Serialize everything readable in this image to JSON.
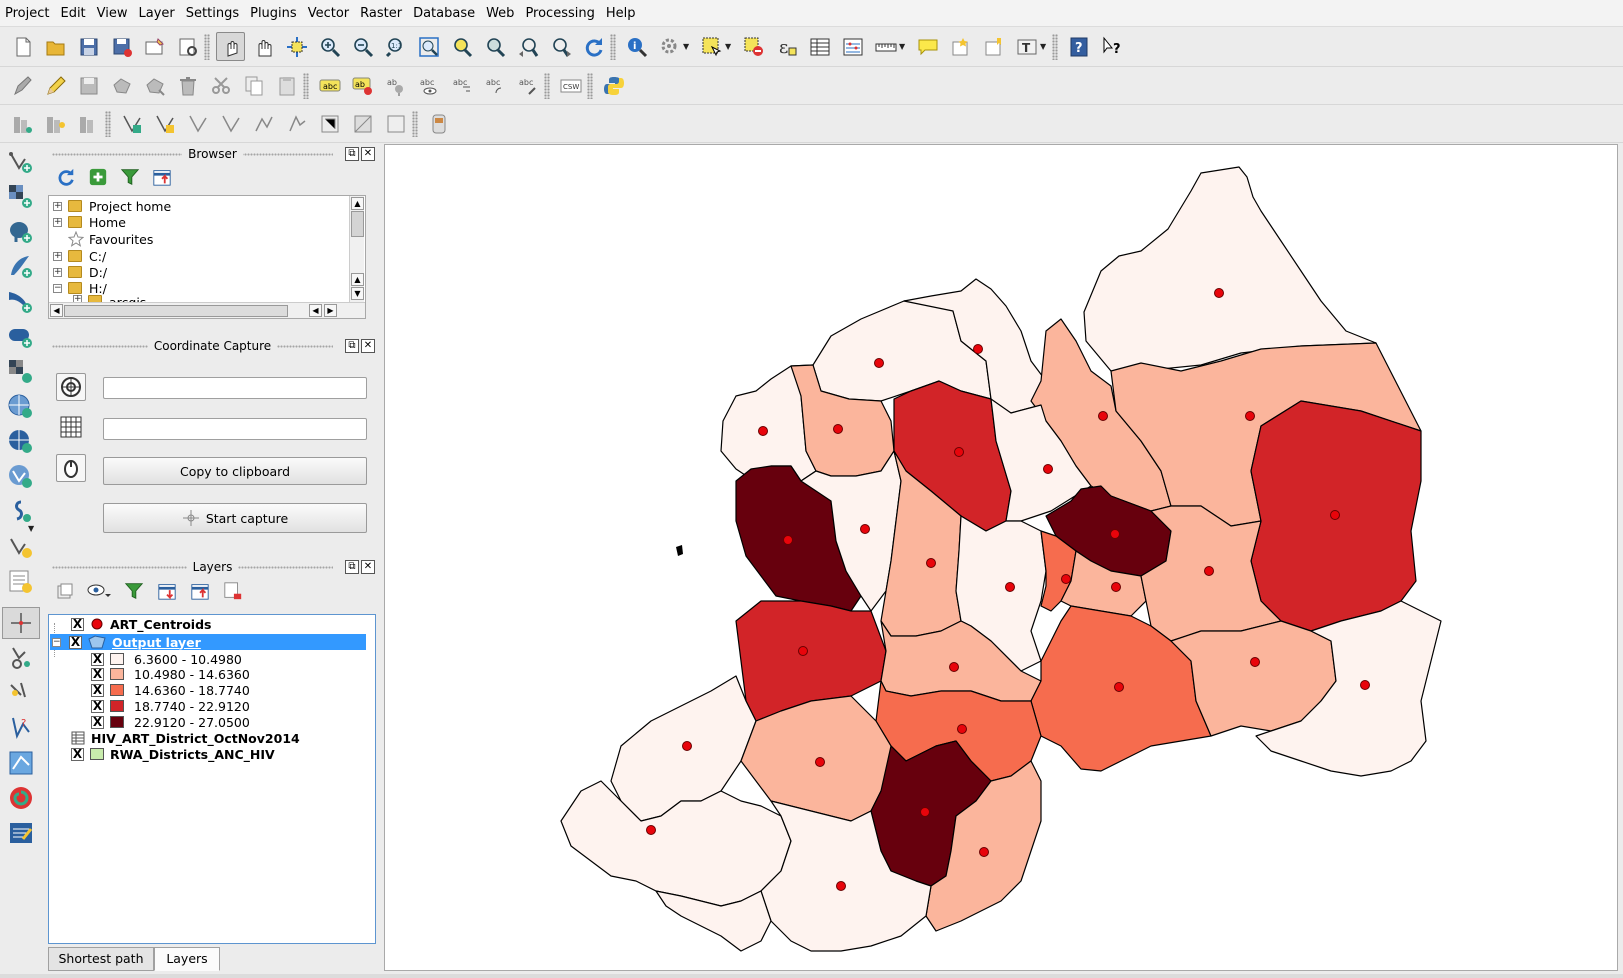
{
  "menubar": {
    "items": [
      "Project",
      "Edit",
      "View",
      "Layer",
      "Settings",
      "Plugins",
      "Vector",
      "Raster",
      "Database",
      "Web",
      "Processing",
      "Help"
    ]
  },
  "toolbars": {
    "row1": [
      "new-project",
      "open-project",
      "save-project",
      "save-as",
      "new-print-composer",
      "composer-manager",
      "touch-zoom-pan",
      "pan-map",
      "pan-to-selection",
      "zoom-in",
      "zoom-out",
      "zoom-native",
      "zoom-full",
      "zoom-to-selection",
      "zoom-to-layer",
      "zoom-last",
      "zoom-next",
      "refresh",
      "identify",
      "action",
      "select-features",
      "deselect",
      "expression-select",
      "attribute-table",
      "statistics",
      "measure",
      "map-tips",
      "new-bookmark",
      "show-bookmarks",
      "annotation",
      "help",
      "whats-this"
    ],
    "row2": [
      "current-edits",
      "toggle-editing",
      "save-layer-edits",
      "add-feature",
      "move-feature",
      "delete-selected",
      "cut-features",
      "copy-features",
      "paste-features",
      "layer-labeling",
      "layer-diagram",
      "pin-labels",
      "show-hide-labels",
      "move-label",
      "rotate-label",
      "change-label",
      "csw-search",
      "python-console"
    ],
    "row3": [
      "digitize-1",
      "digitize-2",
      "digitize-3",
      "add-ring",
      "add-part",
      "fill-ring",
      "delete-ring",
      "delete-part",
      "reshape",
      "offset-curve",
      "split-features",
      "split-parts",
      "gps"
    ]
  },
  "left_toolbar": [
    "add-vector-layer",
    "add-raster-layer",
    "add-postgis-layer",
    "add-spatialite-layer",
    "add-mssql-layer",
    "add-oracle-layer",
    "add-wms-layer",
    "add-wcs-layer",
    "add-wfs-layer",
    "add-delimited-text",
    "new-shapefile",
    "coordinate-capture",
    "georeferencer",
    "topology-checker",
    "heatmap",
    "sql",
    "field-calculator"
  ],
  "browser": {
    "title": "Browser",
    "items": [
      {
        "label": "Project home",
        "icon": "folder-icon",
        "expand": "+"
      },
      {
        "label": "Home",
        "icon": "folder-icon",
        "expand": "+"
      },
      {
        "label": "Favourites",
        "icon": "star-icon",
        "expand": ""
      },
      {
        "label": "C:/",
        "icon": "folder-icon",
        "expand": "+"
      },
      {
        "label": "D:/",
        "icon": "folder-icon",
        "expand": "+"
      },
      {
        "label": "H:/",
        "icon": "folder-icon",
        "expand": "−"
      },
      {
        "label": "arcgis",
        "icon": "folder-icon",
        "expand": "+"
      }
    ]
  },
  "coordinate_capture": {
    "title": "Coordinate Capture",
    "field1_value": "",
    "field2_value": "",
    "copy_label": "Copy to clipboard",
    "start_label": "Start capture"
  },
  "layers": {
    "title": "Layers",
    "entries": [
      {
        "name": "ART_Centroids",
        "checked": "X",
        "symbol": "red-dot"
      },
      {
        "name": "Output layer",
        "checked": "X",
        "symbol": "polygon",
        "selected": true
      },
      {
        "name": "HIV_ART_District_OctNov2014",
        "checked": "",
        "symbol": "table"
      },
      {
        "name": "RWA_Districts_ANC_HIV",
        "checked": "X",
        "symbol": "green-fill"
      }
    ],
    "legend": [
      {
        "label": "6.3600 - 10.4980",
        "color": "#fef3ef"
      },
      {
        "label": "10.4980 - 14.6360",
        "color": "#fbb59c"
      },
      {
        "label": "14.6360 - 18.7740",
        "color": "#f66c4e"
      },
      {
        "label": "18.7740 - 22.9120",
        "color": "#d22428"
      },
      {
        "label": "22.9120 - 27.0500",
        "color": "#67000d"
      }
    ]
  },
  "tabs": [
    "Shortest path",
    "Layers"
  ],
  "map": {
    "polygon_stroke": "#000000",
    "centroid_color": "#e8040b"
  }
}
